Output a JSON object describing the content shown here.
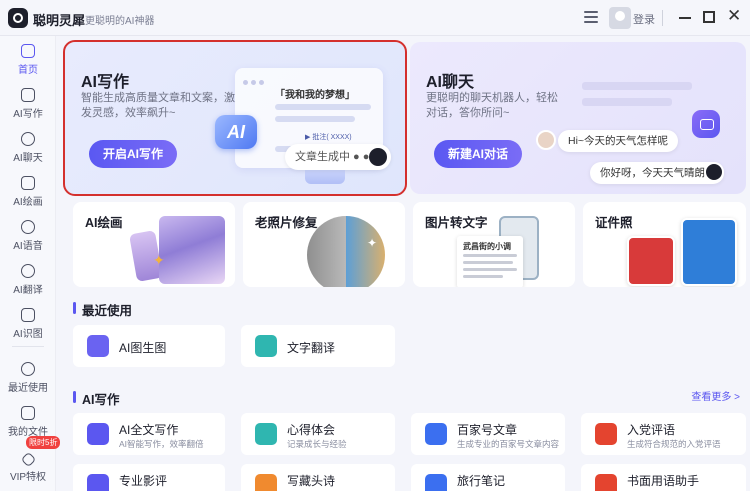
{
  "app": {
    "name": "聪明灵犀",
    "slogan": "更聪明的AI神器",
    "login_label": "登录"
  },
  "sidebar": {
    "items": [
      {
        "label": "首页",
        "icon": "home-icon"
      },
      {
        "label": "AI写作",
        "icon": "pen-icon"
      },
      {
        "label": "AI聊天",
        "icon": "chat-icon"
      },
      {
        "label": "AI绘画",
        "icon": "brush-icon"
      },
      {
        "label": "AI语音",
        "icon": "headphone-icon"
      },
      {
        "label": "AI翻译",
        "icon": "translate-icon"
      },
      {
        "label": "AI识图",
        "icon": "image-scan-icon"
      },
      {
        "label": "最近使用",
        "icon": "clock-icon"
      },
      {
        "label": "我的文件",
        "icon": "file-icon"
      },
      {
        "label": "VIP特权",
        "icon": "diamond-icon"
      }
    ],
    "vip_badge": "限时5折"
  },
  "hero": {
    "write": {
      "title": "AI写作",
      "desc": "智能生成高质量文章和文案，激发灵感，效率飙升~",
      "button": "开启AI写作",
      "mock_heading": "「我和我的梦想」",
      "mock_note": "▶ 批注( XXXX)",
      "ai_badge": "AI",
      "generating": "文章生成中 ● ●"
    },
    "chat": {
      "title": "AI聊天",
      "desc": "更聪明的聊天机器人，轻松对话，答你所问~",
      "button": "新建AI对话",
      "question": "Hi~今天的天气怎样呢",
      "answer": "你好呀，今天天气晴朗..."
    }
  },
  "tools": [
    {
      "name": "AI绘画"
    },
    {
      "name": "老照片修复"
    },
    {
      "name": "图片转文字",
      "doc_title": "武昌街的小调"
    },
    {
      "name": "证件照"
    }
  ],
  "recent": {
    "title": "最近使用",
    "items": [
      {
        "name": "AI图生图",
        "icon": "image-gen-icon",
        "color": "#6a63f1"
      },
      {
        "name": "文字翻译",
        "icon": "text-translate-icon",
        "color": "#2fb6b0"
      }
    ]
  },
  "ai_writing": {
    "title": "AI写作",
    "more": "查看更多 >",
    "items": [
      {
        "name": "AI全文写作",
        "desc": "AI智能写作，效率翻倍",
        "icon": "ai-write-icon",
        "color": "#5b57f0"
      },
      {
        "name": "心得体会",
        "desc": "记录成长与经验",
        "icon": "notes-icon",
        "color": "#2fb6b0"
      },
      {
        "name": "百家号文章",
        "desc": "生成专业的百家号文章内容",
        "icon": "bai-icon",
        "color": "#3b6ff0"
      },
      {
        "name": "入党评语",
        "desc": "生成符合规范的入党评语",
        "icon": "party-icon",
        "color": "#e4442f"
      },
      {
        "name": "专业影评",
        "desc": "",
        "icon": "film-icon",
        "color": "#5b57f0"
      },
      {
        "name": "写藏头诗",
        "desc": "",
        "icon": "poem-icon",
        "color": "#f08a2f"
      },
      {
        "name": "旅行笔记",
        "desc": "",
        "icon": "travel-icon",
        "color": "#3b6ff0"
      },
      {
        "name": "书面用语助手",
        "desc": "",
        "icon": "writing-helper-icon",
        "color": "#e4442f"
      }
    ]
  }
}
